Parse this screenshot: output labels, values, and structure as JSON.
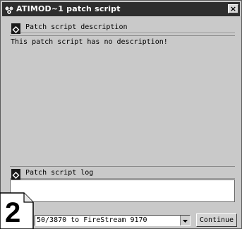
{
  "window": {
    "title": "ATIMOD~1 patch script",
    "close_glyph": "×",
    "icons": {
      "app": "gear-cluster-icon",
      "close": "close-icon"
    }
  },
  "description_section": {
    "label": "Patch script description",
    "icon": "diamond-icon",
    "text": "This patch script has no description!"
  },
  "log_section": {
    "label": "Patch script log",
    "icon": "diamond-icon",
    "text": ""
  },
  "footer": {
    "step_number": "2",
    "device_select_value": "50/3870 to FireStream 9170",
    "continue_label": "Continue"
  },
  "colors": {
    "title_bar": "#2e2e2e",
    "panel_gray": "#c9c9c9",
    "log_background": "#ffffff"
  }
}
